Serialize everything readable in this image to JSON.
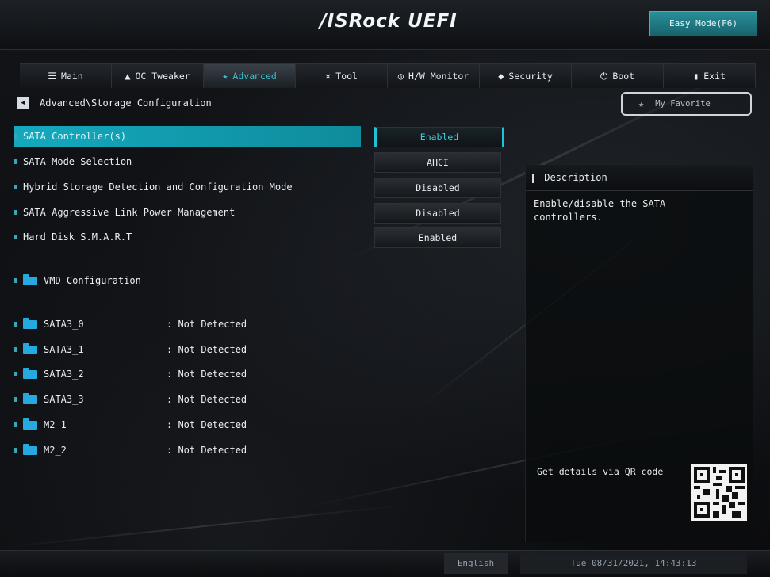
{
  "header": {
    "brand": "/ISRock UEFI",
    "easy_mode": "Easy Mode(F6)"
  },
  "tabs": [
    {
      "label": "Main",
      "icon": "list-icon"
    },
    {
      "label": "OC Tweaker",
      "icon": "rocket-icon"
    },
    {
      "label": "Advanced",
      "icon": "star-icon",
      "active": true
    },
    {
      "label": "Tool",
      "icon": "tools-icon"
    },
    {
      "label": "H/W Monitor",
      "icon": "monitor-icon"
    },
    {
      "label": "Security",
      "icon": "shield-icon"
    },
    {
      "label": "Boot",
      "icon": "power-icon"
    },
    {
      "label": "Exit",
      "icon": "exit-icon"
    }
  ],
  "breadcrumb": "Advanced\\Storage Configuration",
  "favorite": {
    "label": "My Favorite"
  },
  "settings": [
    {
      "label": "SATA Controller(s)",
      "value": "Enabled",
      "selected": true
    },
    {
      "label": "SATA Mode Selection",
      "value": "AHCI"
    },
    {
      "label": "Hybrid Storage Detection and Configuration Mode",
      "value": "Disabled"
    },
    {
      "label": "SATA Aggressive Link Power Management",
      "value": "Disabled"
    },
    {
      "label": "Hard Disk S.M.A.R.T",
      "value": "Enabled"
    }
  ],
  "submenu": {
    "label": "VMD Configuration"
  },
  "devices": [
    {
      "name": "SATA3_0",
      "status": ": Not Detected"
    },
    {
      "name": "SATA3_1",
      "status": ": Not Detected"
    },
    {
      "name": "SATA3_2",
      "status": ": Not Detected"
    },
    {
      "name": "SATA3_3",
      "status": ": Not Detected"
    },
    {
      "name": "M2_1",
      "status": ": Not Detected"
    },
    {
      "name": "M2_2",
      "status": ": Not Detected"
    }
  ],
  "description": {
    "title": "Description",
    "text": "Enable/disable the SATA\ncontrollers.",
    "qr_label": "Get details via QR code"
  },
  "footer": {
    "language": "English",
    "datetime": "Tue 08/31/2021, 14:43:13"
  },
  "colors": {
    "accent": "#14a9bd",
    "background": "#0b0c0e"
  }
}
